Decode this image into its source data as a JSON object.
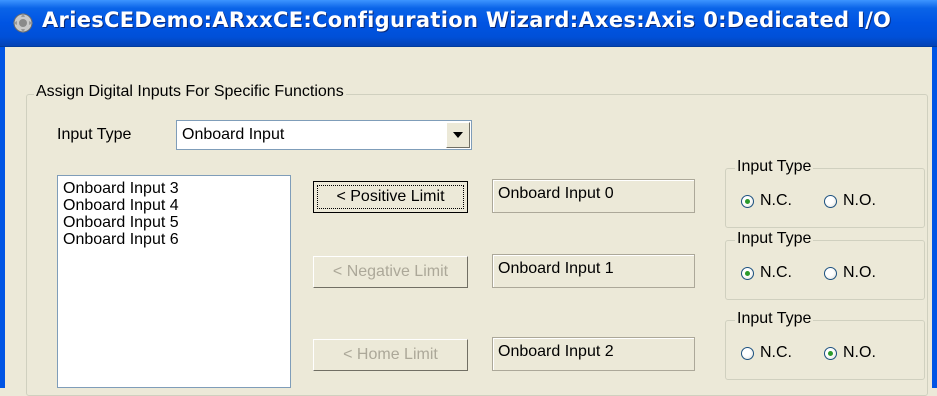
{
  "window": {
    "title": "AriesCEDemo:ARxxCE:Configuration Wizard:Axes:Axis 0:Dedicated I/O"
  },
  "main_group": {
    "legend": "Assign Digital Inputs For Specific Functions",
    "input_type_label": "Input Type",
    "input_type_value": "Onboard Input"
  },
  "available_inputs": [
    "Onboard Input 3",
    "Onboard Input 4",
    "Onboard Input 5",
    "Onboard Input 6"
  ],
  "assignments": [
    {
      "button": "< Positive Limit",
      "enabled": true,
      "value": "Onboard Input 0",
      "group_label": "Input Type",
      "nc_label": "N.C.",
      "no_label": "N.O.",
      "selected": "N.C."
    },
    {
      "button": "< Negative Limit",
      "enabled": false,
      "value": "Onboard Input 1",
      "group_label": "Input Type",
      "nc_label": "N.C.",
      "no_label": "N.O.",
      "selected": "N.C."
    },
    {
      "button": "< Home Limit",
      "enabled": false,
      "value": "Onboard Input 2",
      "group_label": "Input Type",
      "nc_label": "N.C.",
      "no_label": "N.O.",
      "selected": "N.O."
    }
  ],
  "icons": {
    "app": "app-gear-icon",
    "dropdown": "chevron-down-icon"
  },
  "colors": {
    "titlebar": "#0054e3",
    "disabled_text": "#aca899",
    "radio_checked": "#2b9a2b"
  }
}
